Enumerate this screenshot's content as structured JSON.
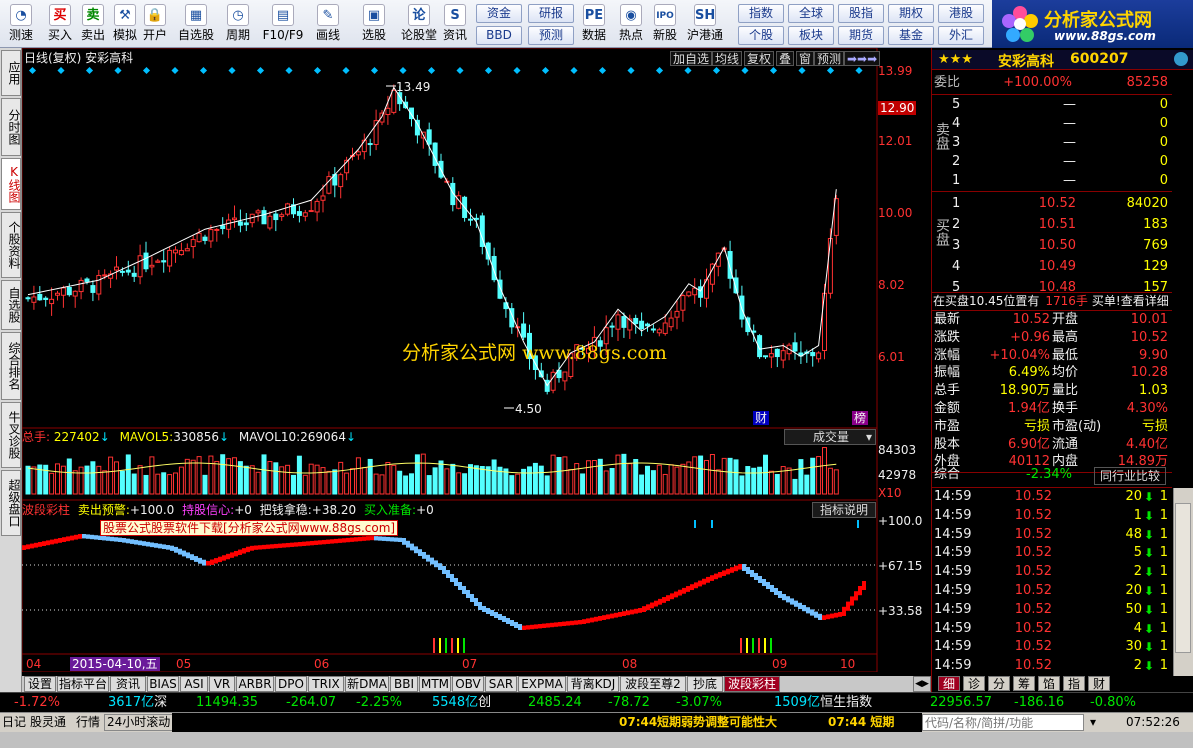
{
  "colors": {
    "up": "#ff3232",
    "down": "#54ffff",
    "ma": "#ffffff",
    "wave_blue": "#72bfff",
    "wave_red": "#ff0000",
    "axis": "#8b0000"
  },
  "toolbar": {
    "items": [
      {
        "label": "测速",
        "icon": "gauge-icon",
        "glyph": "◔"
      },
      {
        "label": "买入",
        "icon": "buy-icon",
        "glyph": "买"
      },
      {
        "label": "卖出",
        "icon": "sell-icon",
        "glyph": "卖"
      },
      {
        "label": "模拟",
        "icon": "hammer-icon",
        "glyph": "⚒"
      },
      {
        "label": "开户",
        "icon": "lock-icon",
        "glyph": "🔒"
      },
      {
        "label": "自选股",
        "icon": "grid-icon",
        "glyph": "▦"
      },
      {
        "label": "周期",
        "icon": "clock-icon",
        "glyph": "◷"
      },
      {
        "label": "F10/F9",
        "icon": "table-icon",
        "glyph": "▤"
      },
      {
        "label": "画线",
        "icon": "pencil-icon",
        "glyph": "✎"
      },
      {
        "label": "选股",
        "icon": "picture-icon",
        "glyph": "▣"
      },
      {
        "label": "论股堂",
        "icon": "discuss-icon",
        "glyph": "论"
      },
      {
        "label": "资讯",
        "icon": "info-icon",
        "glyph": "S"
      },
      {
        "label": "数据",
        "icon": "pe-icon",
        "glyph": "PE"
      },
      {
        "label": "热点",
        "icon": "hot-icon",
        "glyph": "◉"
      },
      {
        "label": "新股",
        "icon": "ipo-icon",
        "glyph": "IPO"
      },
      {
        "label": "沪港通",
        "icon": "hk-icon",
        "glyph": "SH"
      }
    ],
    "group1": [
      "资金",
      "研报",
      "BBD",
      "预测"
    ],
    "group2": [
      "指数",
      "全球",
      "股指",
      "期权",
      "港股",
      "个股",
      "板块",
      "期货",
      "基金",
      "外汇"
    ]
  },
  "logo": {
    "text": "分析家公式网",
    "url": "www.88gs.com"
  },
  "side_tabs": [
    "应用",
    "分时图",
    "K线图",
    "个股资料",
    "自选股",
    "综合排名",
    "牛叉诊股",
    "超级盘口"
  ],
  "chart": {
    "title": "日线(复权)  安彩高科",
    "top_buttons": [
      "加自选",
      "均线",
      "复权",
      "叠",
      "窗",
      "预测",
      "➡➡➡"
    ],
    "price_axis": [
      "13.99",
      "12.90",
      "12.01",
      "10.00",
      "8.02",
      "6.01"
    ],
    "highlight_price": "12.90",
    "high_label": "13.49",
    "low_label": "4.50",
    "watermark": "分析家公式网   www.88gs.com",
    "badges": [
      "财",
      "榜"
    ],
    "volume": {
      "name": "总手",
      "value": "227402",
      "ma5_label": "MAVOL5:",
      "ma5": "330856",
      "ma10_label": "MAVOL10:",
      "ma10": "269064",
      "selector": "成交量",
      "axis": [
        "84303",
        "42978",
        "X10"
      ]
    },
    "indicator": {
      "name": "波段彩柱",
      "a_label": "卖出预警:",
      "a": "+100.0",
      "b_label": "持股信心:",
      "b": "+0",
      "c_label": "把钱拿稳:",
      "c": "+38.20",
      "d_label": "买入准备:",
      "d": "+0",
      "explain": "指标说明",
      "axis": [
        "+100.0",
        "+67.15",
        "+33.58"
      ],
      "ad": "股票公式股票软件下载[分析家公式网www.88gs.com]"
    },
    "xaxis": [
      "04",
      "2015-04-10,五",
      "05",
      "06",
      "07",
      "08",
      "09",
      "10"
    ]
  },
  "bottom_tabs": [
    "设置",
    "指标平台",
    "资讯",
    "BIAS",
    "ASI",
    "VR",
    "ARBR",
    "DPO",
    "TRIX",
    "新DMA",
    "BBI",
    "MTM",
    "OBV",
    "SAR",
    "EXPMA",
    "背离KDJ",
    "波段至尊2",
    "抄底",
    "波段彩柱"
  ],
  "right": {
    "header": {
      "stars": "★★★",
      "name": "安彩高科",
      "code": "600207"
    },
    "weibi": {
      "label": "委比",
      "value": "+100.00%",
      "diff": "85258"
    },
    "sell_label": "卖盘",
    "buy_label": "买盘",
    "sells": [
      {
        "n": "5",
        "p": "—",
        "v": "0"
      },
      {
        "n": "4",
        "p": "—",
        "v": "0"
      },
      {
        "n": "3",
        "p": "—",
        "v": "0"
      },
      {
        "n": "2",
        "p": "—",
        "v": "0"
      },
      {
        "n": "1",
        "p": "—",
        "v": "0"
      }
    ],
    "buys": [
      {
        "n": "1",
        "p": "10.52",
        "v": "84020"
      },
      {
        "n": "2",
        "p": "10.51",
        "v": "183"
      },
      {
        "n": "3",
        "p": "10.50",
        "v": "769"
      },
      {
        "n": "4",
        "p": "10.49",
        "v": "129"
      },
      {
        "n": "5",
        "p": "10.48",
        "v": "157"
      }
    ],
    "zaimai": {
      "a": "在买盘10.45位置有",
      "b": "1716手",
      "c": "买单!查看详细"
    },
    "quote": [
      {
        "k1": "最新",
        "v1": "10.52",
        "k2": "开盘",
        "v2": "10.01"
      },
      {
        "k1": "涨跌",
        "v1": "+0.96",
        "k2": "最高",
        "v2": "10.52"
      },
      {
        "k1": "涨幅",
        "v1": "+10.04%",
        "k2": "最低",
        "v2": "9.90"
      },
      {
        "k1": "振幅",
        "v1": "6.49%",
        "k2": "均价",
        "v2": "10.28"
      },
      {
        "k1": "总手",
        "v1": "18.90万",
        "k2": "量比",
        "v2": "1.03"
      },
      {
        "k1": "金额",
        "v1": "1.94亿",
        "k2": "换手",
        "v2": "4.30%"
      },
      {
        "k1": "市盈",
        "v1": "亏损",
        "k2": "市盈(动)",
        "v2": "亏损"
      },
      {
        "k1": "股本",
        "v1": "6.90亿",
        "k2": "流通",
        "v2": "4.40亿"
      },
      {
        "k1": "外盘",
        "v1": "40112",
        "k2": "内盘",
        "v2": "14.89万"
      }
    ],
    "zonghe": {
      "label": "综合",
      "value": "-2.34%",
      "btn": "同行业比较"
    },
    "ticks": [
      {
        "t": "14:59",
        "p": "10.52",
        "v": "20",
        "n": "1"
      },
      {
        "t": "14:59",
        "p": "10.52",
        "v": "1",
        "n": "1"
      },
      {
        "t": "14:59",
        "p": "10.52",
        "v": "48",
        "n": "1"
      },
      {
        "t": "14:59",
        "p": "10.52",
        "v": "5",
        "n": "1"
      },
      {
        "t": "14:59",
        "p": "10.52",
        "v": "2",
        "n": "1"
      },
      {
        "t": "14:59",
        "p": "10.52",
        "v": "20",
        "n": "1"
      },
      {
        "t": "14:59",
        "p": "10.52",
        "v": "50",
        "n": "1"
      },
      {
        "t": "14:59",
        "p": "10.52",
        "v": "4",
        "n": "1"
      },
      {
        "t": "14:59",
        "p": "10.52",
        "v": "30",
        "n": "1"
      },
      {
        "t": "14:59",
        "p": "10.52",
        "v": "2",
        "n": "1"
      }
    ],
    "tabs": [
      "细",
      "诊",
      "分",
      "筹",
      "馅",
      "指",
      "财"
    ]
  },
  "ticker": {
    "a": "-1.72%",
    "b": "3617亿",
    "c": "深",
    "d": "11494.35",
    "e": "-264.07",
    "f": "-2.25%",
    "g": "5548亿",
    "h": "创",
    "i": "2485.24",
    "j": "-78.72",
    "k": "-3.07%",
    "l": "1509亿",
    "m": "恒生指数",
    "n": "22956.57",
    "o": "-186.16",
    "p": "-0.80%"
  },
  "status": {
    "items": [
      "日记",
      "股灵通",
      "行情",
      "24小时滚动"
    ],
    "news_time": "07:44",
    "news": "短期弱势调整可能性大",
    "news2": "07:44 短期",
    "input": "代码/名称/简拼/功能",
    "clock": "07:52:26"
  }
}
